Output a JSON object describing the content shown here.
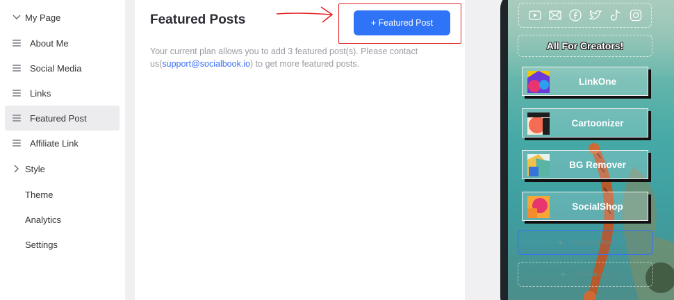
{
  "sidebar": {
    "items": [
      {
        "label": "My Page",
        "icon": "chevron-down-icon"
      },
      {
        "label": "About Me",
        "icon": "drag-handle-icon"
      },
      {
        "label": "Social Media",
        "icon": "drag-handle-icon"
      },
      {
        "label": "Links",
        "icon": "drag-handle-icon"
      },
      {
        "label": "Featured Post",
        "icon": "drag-handle-icon",
        "active": true
      },
      {
        "label": "Affiliate Link",
        "icon": "drag-handle-icon"
      },
      {
        "label": "Style",
        "icon": "chevron-right-icon"
      },
      {
        "label": "Theme"
      },
      {
        "label": "Analytics"
      },
      {
        "label": "Settings"
      }
    ]
  },
  "main": {
    "title": "Featured Posts",
    "add_button_label": "+ Featured Post",
    "description_before": "Your current plan allows you to add 3 featured post(s). Please contact us(",
    "description_link": "support@socialbook.io",
    "description_after": ") to get more featured posts."
  },
  "preview": {
    "social_icons": [
      "youtube-icon",
      "email-icon",
      "facebook-icon",
      "twitter-icon",
      "tiktok-icon",
      "instagram-icon"
    ],
    "heading": "All For Creators!",
    "links": [
      {
        "name": "LinkOne"
      },
      {
        "name": "Cartoonizer"
      },
      {
        "name": "BG Remover"
      },
      {
        "name": "SocialShop"
      }
    ],
    "featured_post_placeholder": "Featured Post",
    "affiliate_link_placeholder": "Affiliate Link"
  },
  "colors": {
    "accent": "#2f73f6",
    "highlight": "#e0201f",
    "active_item_bg": "#ececef"
  }
}
